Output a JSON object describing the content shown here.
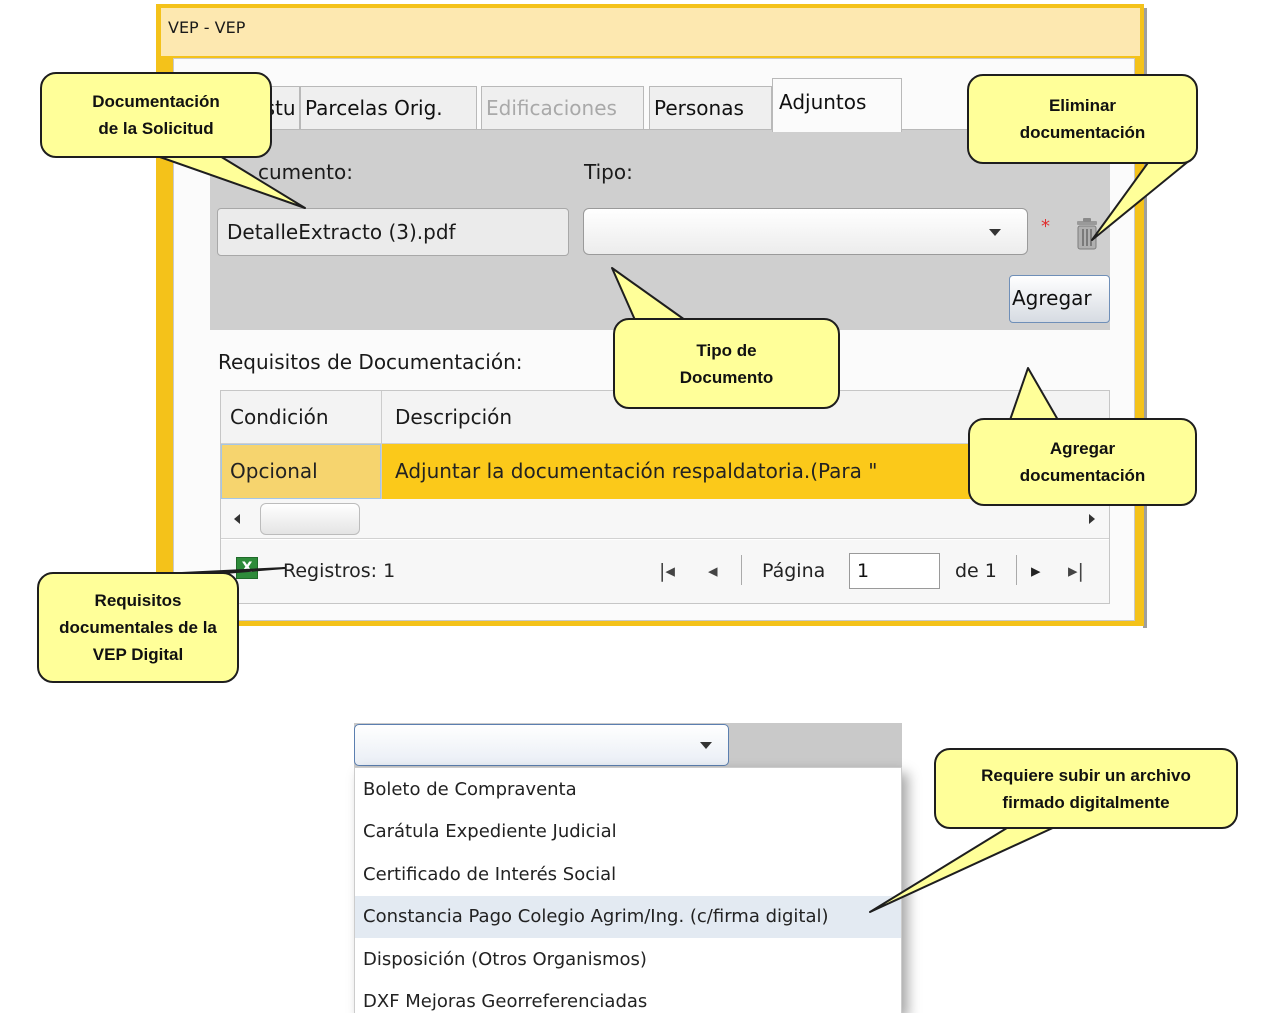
{
  "window": {
    "title": "VEP  -  VEP"
  },
  "tabs": [
    {
      "label": "Estu",
      "state": "normal"
    },
    {
      "label": "Parcelas Orig.",
      "state": "normal"
    },
    {
      "label": "Edificaciones",
      "state": "disabled"
    },
    {
      "label": "Personas",
      "state": "normal"
    },
    {
      "label": "Adjuntos",
      "state": "active"
    }
  ],
  "form": {
    "documento_label": "cumento:",
    "tipo_label": "Tipo:",
    "documento_value": "DetalleExtracto (3).pdf",
    "tipo_value": "",
    "required_mark": "*",
    "agregar_label": "Agregar"
  },
  "requirements": {
    "title": "Requisitos de Documentación:",
    "columns": [
      "Condición",
      "Descripción"
    ],
    "rows": [
      {
        "condicion": "Opcional",
        "descripcion": "Adjuntar la documentación respaldatoria.(Para \""
      }
    ]
  },
  "pager": {
    "records_label": "Registros: 1",
    "page_label": "Página",
    "page_value": "1",
    "of_label": "de 1"
  },
  "dropdown": {
    "items": [
      "Boleto de Compraventa",
      "Carátula Expediente Judicial",
      "Certificado de Interés Social",
      "Constancia Pago Colegio Agrim/Ing. (c/firma digital)",
      "Disposición (Otros Organismos)",
      "DXF Mejoras Georreferenciadas"
    ],
    "highlighted_index": 3
  },
  "callouts": {
    "documentacion": "Documentación de la Solicitud",
    "eliminar": "Eliminar documentación",
    "tipo": "Tipo de Documento",
    "agregar": "Agregar documentación",
    "requisitos": "Requisitos documentales de la VEP Digital",
    "firma": "Requiere subir un archivo firmado digitalmente"
  },
  "colors": {
    "window_border": "#f4c21a",
    "row_highlight": "#fbc91a",
    "callout_fill": "#ffff99"
  }
}
